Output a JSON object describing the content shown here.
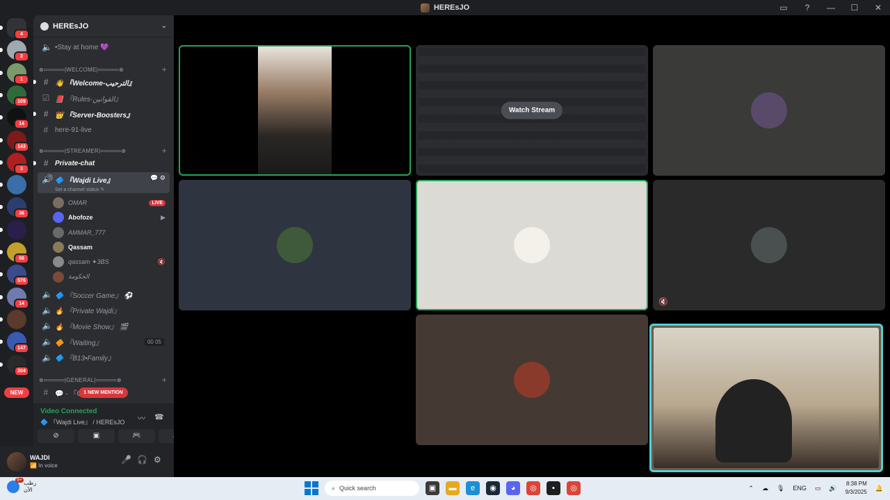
{
  "window": {
    "title": "HEREsJO",
    "controls": {
      "inbox": "▭",
      "help": "?",
      "minimize": "—",
      "maximize": "☐",
      "close": "✕"
    }
  },
  "rail": {
    "servers": [
      {
        "badge": "4",
        "color": "#5865f2"
      },
      {
        "badge": "2",
        "color": "#a0a8b0"
      },
      {
        "badge": "1",
        "color": "#7a9a6a"
      },
      {
        "badge": "109",
        "color": "#2f6b3a"
      },
      {
        "badge": "14",
        "color": "#111111"
      },
      {
        "badge": "143",
        "color": "#7d1a1a"
      },
      {
        "badge": "3",
        "color": "#b01e1e"
      },
      {
        "badge": "",
        "color": "#3a6ea8"
      },
      {
        "badge": "36",
        "color": "#2c3e70"
      },
      {
        "badge": "",
        "color": "#2a1f4a"
      },
      {
        "badge": "66",
        "color": "#c2a02a"
      },
      {
        "badge": "576",
        "color": "#3b4a8a"
      },
      {
        "badge": "14",
        "color": "#6e7ab0"
      },
      {
        "badge": "",
        "color": "#5a3a2a"
      },
      {
        "badge": "147",
        "color": "#3a5ab0"
      },
      {
        "badge": "204",
        "color": "#2a2a2a"
      }
    ],
    "new_label": "NEW"
  },
  "server": {
    "name": "HEREsJO",
    "stay_at_home": "•Stay at home 💜",
    "categories": {
      "welcome": "⊗═════|WELCOME|═════⊗",
      "streamer": "⊗═════|STREAMER|═════⊗",
      "general": "⊗═════|GENERAL|═════⊗"
    },
    "text_channels": {
      "welcome": "👋 『Welcome-الترحيب』",
      "rules": "📕 『Rules-القوانين』",
      "boosters": "👑 『Server-Boosters』",
      "live": "here-91-live",
      "private_chat": "Private-chat",
      "general_first": "💬 - 『C"
    },
    "active_voice": {
      "name": "🔷 『Wajdi Live』",
      "status": "Set a channel status ✎"
    },
    "voice_users": [
      {
        "name": "OMAR",
        "tag": "LIVE",
        "active": false,
        "color": "#7d6d60"
      },
      {
        "name": "Abofoze",
        "tag": "▶",
        "active": true,
        "color": "#5865f2"
      },
      {
        "name": "AMMAR_777",
        "tag": "",
        "active": false,
        "color": "#6a6a6a"
      },
      {
        "name": "Qassam",
        "tag": "",
        "active": true,
        "color": "#8a7a5a"
      },
      {
        "name": "qassam  ✦3BS",
        "tag": "🔇",
        "active": false,
        "color": "#8a8a8a"
      },
      {
        "name": "الحكومة",
        "tag": "",
        "active": false,
        "color": "#7a4a3a"
      }
    ],
    "voice_channels": [
      {
        "name": "🔷 『Soccer Game』 ⚽",
        "right": ""
      },
      {
        "name": "🔥 『Private Wajdi』",
        "right": ""
      },
      {
        "name": "🔥 『Movie Show』 🎬",
        "right": ""
      },
      {
        "name": "🔶 『Waiting』",
        "right": "00  05"
      },
      {
        "name": "🔷 『B13•Family』",
        "right": ""
      }
    ],
    "mention_label": "1 NEW MENTION"
  },
  "rtc": {
    "status": "Video Connected",
    "channel": "🔷 『Wajdi Live』 / HEREsJO",
    "buttons": [
      "⊘",
      "▣",
      "🎮",
      "✨"
    ]
  },
  "user": {
    "name": "WAJDI",
    "status": "📶 In voice",
    "mic": "🎤",
    "headset": "🎧",
    "settings": "⚙"
  },
  "stage": {
    "watch_label": "Watch Stream",
    "mute_icon": "🔇",
    "tiles": [
      {
        "bg": "#000000",
        "avatar": "",
        "speaking": true,
        "kind": "video"
      },
      {
        "bg": "#2a2b2e",
        "avatar": "",
        "speaking": false,
        "kind": "stream"
      },
      {
        "bg": "#3a3a39",
        "avatar": "#5a4a6a",
        "speaking": false,
        "kind": "avatar"
      },
      {
        "bg": "#2e3540",
        "avatar": "#3f5a3a",
        "speaking": false,
        "kind": "avatar"
      },
      {
        "bg": "#dcdad5",
        "avatar": "#f4f1ea",
        "speaking": true,
        "kind": "avatar"
      },
      {
        "bg": "#2a2a2b",
        "avatar": "#4a5050",
        "speaking": false,
        "kind": "avatar-muted"
      },
      {
        "bg": "#453a33",
        "avatar": "#8a3a2a",
        "speaking": false,
        "kind": "avatar"
      }
    ]
  },
  "taskbar": {
    "weather_label": "رطب",
    "weather_sub": "الآن",
    "weather_badge": "9+",
    "search_placeholder": "Quick search",
    "lang": "ENG",
    "time": "8:38 PM",
    "date": "9/3/2025"
  }
}
